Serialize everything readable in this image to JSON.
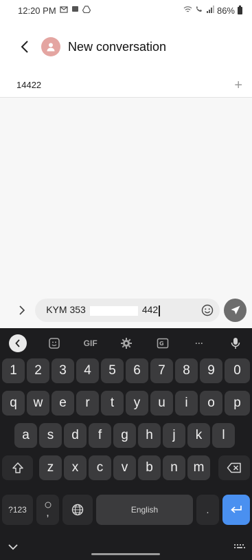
{
  "status_bar": {
    "time": "12:20 PM",
    "battery": "86%"
  },
  "header": {
    "title": "New conversation"
  },
  "recipient": {
    "value": "14422",
    "add_icon": "+"
  },
  "compose": {
    "text_start": "KYM 353",
    "text_end": "442"
  },
  "keyboard": {
    "toolbar": {
      "gif": "GIF",
      "more": "···"
    },
    "number_row": [
      "1",
      "2",
      "3",
      "4",
      "5",
      "6",
      "7",
      "8",
      "9",
      "0"
    ],
    "row1": [
      "q",
      "w",
      "e",
      "r",
      "t",
      "y",
      "u",
      "i",
      "o",
      "p"
    ],
    "row2": [
      "a",
      "s",
      "d",
      "f",
      "g",
      "h",
      "j",
      "k",
      "l"
    ],
    "row3": [
      "z",
      "x",
      "c",
      "v",
      "b",
      "n",
      "m"
    ],
    "symbols_key": "?123",
    "comma_key": ",",
    "period_key": ".",
    "space_label": "English"
  },
  "colors": {
    "send_button": "#6d6d6d",
    "enter_key": "#4a90f0",
    "avatar": "#e4a5a1",
    "keyboard_bg": "#1d1d1f"
  }
}
